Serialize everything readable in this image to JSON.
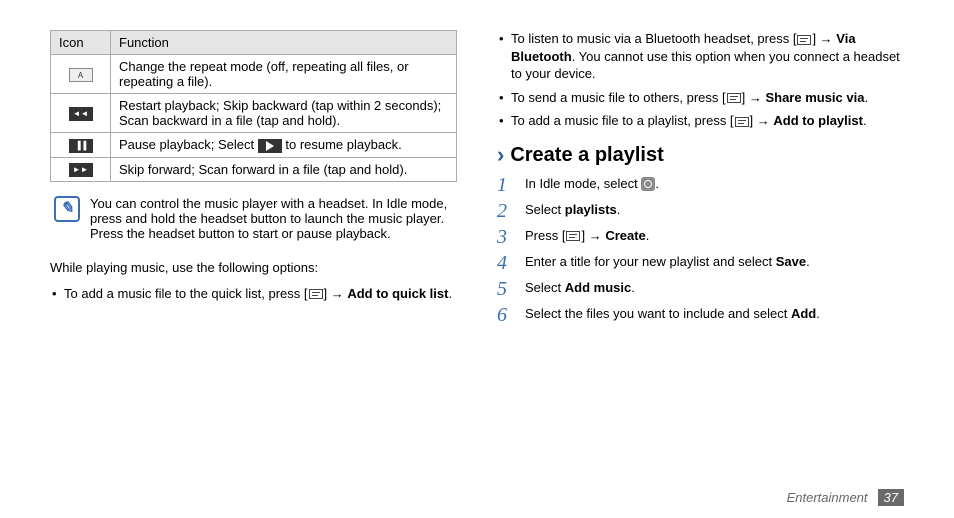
{
  "table": {
    "head_icon": "Icon",
    "head_func": "Function",
    "rows": [
      {
        "icon_label": "A",
        "icon_style": "light",
        "func": "Change the repeat mode (off, repeating all files, or repeating a file)."
      },
      {
        "icon_label": "◄◄",
        "icon_style": "dark",
        "func": "Restart playback; Skip backward (tap within 2 seconds); Scan backward in a file (tap and hold)."
      },
      {
        "icon_label": "▐▐",
        "icon_style": "dark",
        "func_prefix": "Pause playback; Select ",
        "func_suffix": " to resume playback."
      },
      {
        "icon_label": "►►",
        "icon_style": "dark",
        "func": "Skip forward; Scan forward in a file (tap and hold)."
      }
    ]
  },
  "note": "You can control the music player with a headset. In Idle mode, press and hold the headset button to launch the music player. Press the headset button to start or pause playback.",
  "while_playing": "While playing music, use the following options:",
  "left_bullets": [
    {
      "prefix": "To add a music file to the quick list, press [",
      "suffix": "] → ",
      "bold": "Add to quick list",
      "end": "."
    }
  ],
  "right_bullets": [
    {
      "prefix": "To listen to music via a Bluetooth headset, press [",
      "suffix": "] → ",
      "bold": "Via Bluetooth",
      "end": ". You cannot use this option when you connect a headset to your device."
    },
    {
      "prefix": "To send a music file to others, press [",
      "suffix": "] → ",
      "bold": "Share music via",
      "end": "."
    },
    {
      "prefix": "To add a music file to a playlist, press [",
      "suffix": "] → ",
      "bold": "Add to playlist",
      "end": "."
    }
  ],
  "section_title": "Create a playlist",
  "steps": [
    {
      "n": "1",
      "text_before": "In Idle mode, select ",
      "text_after": "."
    },
    {
      "n": "2",
      "text_before": "Select ",
      "bold": "playlists",
      "text_after": "."
    },
    {
      "n": "3",
      "text_before": "Press [",
      "text_mid": "] → ",
      "bold": "Create",
      "text_after": "."
    },
    {
      "n": "4",
      "text_before": "Enter a title for your new playlist and select ",
      "bold": "Save",
      "text_after": "."
    },
    {
      "n": "5",
      "text_before": "Select ",
      "bold": "Add music",
      "text_after": "."
    },
    {
      "n": "6",
      "text_before": "Select the files you want to include and select ",
      "bold": "Add",
      "text_after": "."
    }
  ],
  "footer_section": "Entertainment",
  "page_number": "37"
}
